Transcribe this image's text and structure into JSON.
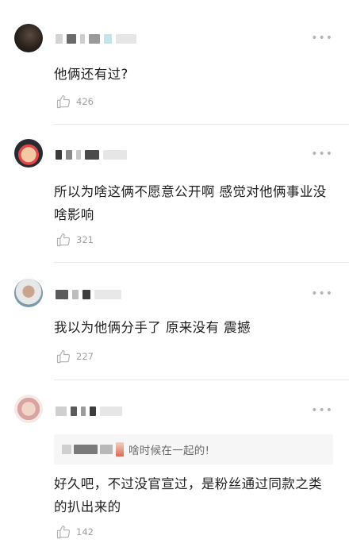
{
  "comments": [
    {
      "text": "他俩还有过?",
      "likes": "426"
    },
    {
      "text": "所以为啥这俩不愿意公开啊 感觉对他俩事业没啥影响",
      "likes": "321"
    },
    {
      "text": "我以为他俩分手了 原来没有 震撼",
      "likes": "227"
    },
    {
      "text": "好久吧，不过没官宣过，是粉丝通过同款之类的扒出来的",
      "likes": "142",
      "reply_quote": "啥时候在一起的!"
    }
  ],
  "icons": {
    "more": "more-icon",
    "like": "thumbs-up-icon"
  },
  "more_glyph": "•••",
  "colors": {
    "text": "#1e1e1e",
    "muted": "#a0a0a0",
    "divider": "#e8e8e8",
    "reply_bg": "#f6f6f6"
  }
}
